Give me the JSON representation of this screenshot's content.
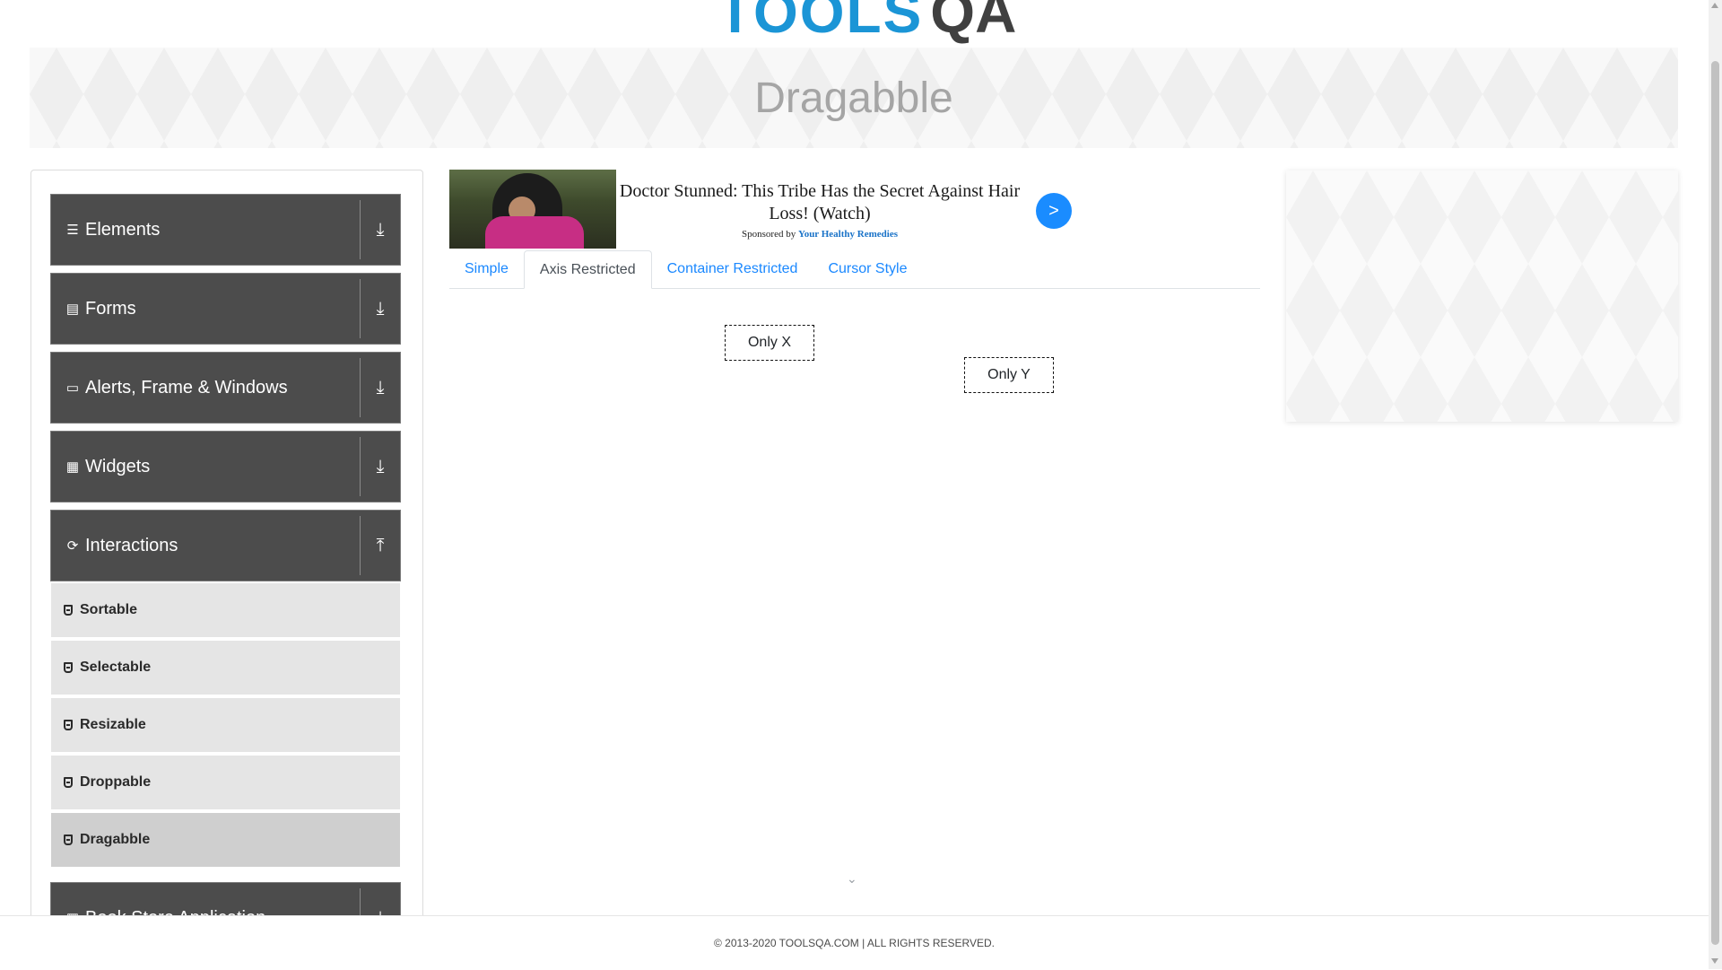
{
  "brand": {
    "logo_text": "TOOLS",
    "logo_qa": "QA",
    "accent": "#1b95d6"
  },
  "page": {
    "title": "Dragabble"
  },
  "sidebar": {
    "groups": [
      {
        "label": "Elements",
        "icon": "hamburger-icon",
        "arrow": "download-icon"
      },
      {
        "label": "Forms",
        "icon": "document-icon",
        "arrow": "download-icon"
      },
      {
        "label": "Alerts, Frame & Windows",
        "icon": "window-icon",
        "arrow": "download-icon"
      },
      {
        "label": "Widgets",
        "icon": "widgets-icon",
        "arrow": "download-icon"
      },
      {
        "label": "Interactions",
        "icon": "sync-icon",
        "arrow": "upload-icon"
      },
      {
        "label": "Book Store Application",
        "icon": "books-icon",
        "arrow": "download-icon"
      }
    ],
    "items": [
      {
        "label": "Sortable"
      },
      {
        "label": "Selectable"
      },
      {
        "label": "Resizable"
      },
      {
        "label": "Droppable"
      },
      {
        "label": "Dragabble"
      }
    ],
    "active_item": "Dragabble"
  },
  "ad": {
    "title": "Doctor Stunned: This Tribe Has the Secret Against Hair Loss! (Watch)",
    "sponsored_by": "Sponsored by",
    "sponsor": "Your Healthy Remedies",
    "go": ">"
  },
  "tabs": [
    {
      "label": "Simple"
    },
    {
      "label": "Axis Restricted"
    },
    {
      "label": "Container Restricted"
    },
    {
      "label": "Cursor Style"
    }
  ],
  "active_tab": "Axis Restricted",
  "draggables": {
    "only_x": "Only X",
    "only_y": "Only Y"
  },
  "footer": {
    "text": "© 2013-2020 TOOLSQA.COM | ALL RIGHTS RESERVED."
  }
}
